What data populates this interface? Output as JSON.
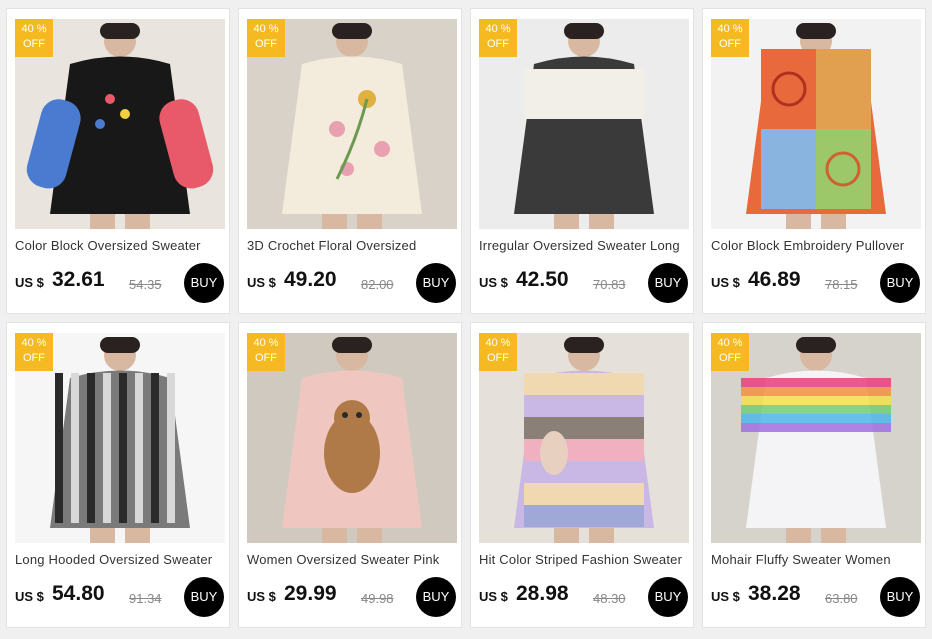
{
  "products": [
    {
      "title": "Color Block Oversized Sweater",
      "currency": "US $",
      "price": "32.61",
      "old_price": "54.35",
      "discount_line1": "40 %",
      "discount_line2": "OFF",
      "buy_label": "BUY",
      "image": {
        "background": "#e9e4dd",
        "garment": "#181818",
        "accent": "#4a7bd0",
        "accent2": "#e85a6a"
      }
    },
    {
      "title": "3D Crochet Floral Oversized",
      "currency": "US $",
      "price": "49.20",
      "old_price": "82.00",
      "discount_line1": "40 %",
      "discount_line2": "OFF",
      "buy_label": "BUY",
      "image": {
        "background": "#d9d2c8",
        "garment": "#f3ecdc",
        "accent": "#e0b040",
        "accent2": "#e9a0b0"
      }
    },
    {
      "title": "Irregular Oversized Sweater Long",
      "currency": "US $",
      "price": "42.50",
      "old_price": "70.83",
      "discount_line1": "40 %",
      "discount_line2": "OFF",
      "buy_label": "BUY",
      "image": {
        "background": "#ececec",
        "garment": "#3a3a3a",
        "accent": "#f1efe8",
        "accent2": "#3a3a3a"
      }
    },
    {
      "title": "Color Block Embroidery Pullover",
      "currency": "US $",
      "price": "46.89",
      "old_price": "78.15",
      "discount_line1": "40 %",
      "discount_line2": "OFF",
      "buy_label": "BUY",
      "image": {
        "background": "#f2f2f2",
        "garment": "#e86a3c",
        "accent": "#8ab4e0",
        "accent2": "#9cc86a"
      }
    },
    {
      "title": "Long Hooded Oversized Sweater",
      "currency": "US $",
      "price": "54.80",
      "old_price": "91.34",
      "discount_line1": "40 %",
      "discount_line2": "OFF",
      "buy_label": "BUY",
      "image": {
        "background": "#f6f6f6",
        "garment": "#7a7a7a",
        "accent": "#2a2a2a",
        "accent2": "#d8d8d8"
      }
    },
    {
      "title": "Women Oversized Sweater Pink",
      "currency": "US $",
      "price": "29.99",
      "old_price": "49.98",
      "discount_line1": "40 %",
      "discount_line2": "OFF",
      "buy_label": "BUY",
      "image": {
        "background": "#cfc9c0",
        "garment": "#efc7c0",
        "accent": "#b07a48",
        "accent2": "#2a2a2a"
      }
    },
    {
      "title": "Hit Color Striped Fashion Sweater",
      "currency": "US $",
      "price": "28.98",
      "old_price": "48.30",
      "discount_line1": "40 %",
      "discount_line2": "OFF",
      "buy_label": "BUY",
      "image": {
        "background": "#e6e0da",
        "garment": "#c9b8e6",
        "accent": "#f0d8b0",
        "accent2": "#8a8078"
      }
    },
    {
      "title": "Mohair Fluffy Sweater Women",
      "currency": "US $",
      "price": "38.28",
      "old_price": "63.80",
      "discount_line1": "40 %",
      "discount_line2": "OFF",
      "buy_label": "BUY",
      "image": {
        "background": "#d6d2cc",
        "garment": "#f4f4f6",
        "accent": "#e8407a",
        "accent2": "#4ab8e8"
      }
    }
  ]
}
